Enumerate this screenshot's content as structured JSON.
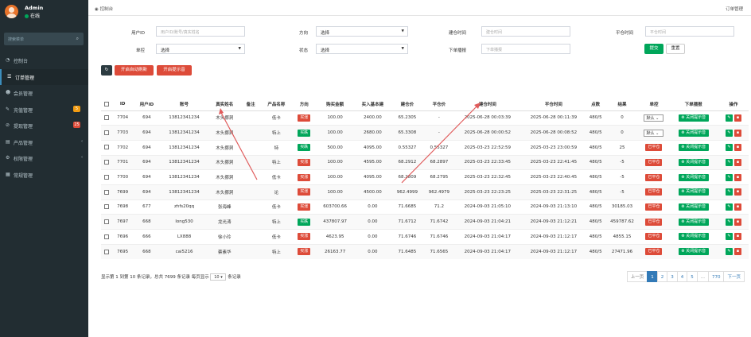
{
  "user": {
    "name": "Admin",
    "status": "在线"
  },
  "sidebar": {
    "search_placeholder": "搜索菜单",
    "items": [
      {
        "label": "控制台",
        "icon": "dashboard-icon"
      },
      {
        "label": "订单管理",
        "icon": "list-icon"
      },
      {
        "label": "会员管理",
        "icon": "users-icon"
      },
      {
        "label": "充值管理",
        "icon": "recharge-icon",
        "badge": "5"
      },
      {
        "label": "提现管理",
        "icon": "withdraw-icon",
        "badge": "25"
      },
      {
        "label": "产品管理",
        "icon": "product-icon"
      },
      {
        "label": "权限管理",
        "icon": "permission-icon"
      },
      {
        "label": "常规管理",
        "icon": "settings-icon"
      }
    ]
  },
  "topbar": {
    "breadcrumb": "控制台",
    "right": "订单管理"
  },
  "filters": {
    "user_id": {
      "label": "用户ID",
      "placeholder": "用户ID/账号/真实姓名"
    },
    "direction": {
      "label": "方向",
      "value": "选择"
    },
    "create_time": {
      "label": "建仓时间",
      "placeholder": "建仓时间"
    },
    "close_time": {
      "label": "平仓时间",
      "placeholder": "平仓时间"
    },
    "control": {
      "label": "单控",
      "value": "选择"
    },
    "status": {
      "label": "状态",
      "value": "选择"
    },
    "order_fee": {
      "label": "下单播报",
      "placeholder": "下单播报"
    },
    "submit": "提交",
    "reset": "重置"
  },
  "toolbar": {
    "refresh_icon": "refresh-icon",
    "auto_refresh": "开启自动刷新",
    "open_notify": "开启提示音"
  },
  "table": {
    "headers": [
      "",
      "ID",
      "用户ID",
      "账号",
      "真实姓名",
      "备注",
      "产品名称",
      "方向",
      "购买金额",
      "买入基本建",
      "建仓价",
      "平仓价",
      "建仓时间",
      "平仓时间",
      "点数",
      "结果",
      "单控",
      "下单播报",
      "操作"
    ],
    "rows": [
      {
        "id": "7704",
        "uid": "694",
        "account": "13812341234",
        "name": "木头挪洞",
        "note": "",
        "product": "低卡",
        "dir": "买涨",
        "dir_color": "#dd4b39",
        "amount": "100.00",
        "base": "2400.00",
        "open": "65.2305",
        "close": "-",
        "ctime": "2025-06-28 00:03:39",
        "ptime": "2025-06-28 00:11:39",
        "pts": "480/5",
        "result": "0",
        "ctrl": "select",
        "ctrl_val": "默认",
        "notify": "关闭提示音"
      },
      {
        "id": "7703",
        "uid": "694",
        "account": "13812341234",
        "name": "木头挪洞",
        "note": "",
        "product": "特上",
        "dir": "买跌",
        "dir_color": "#00a65a",
        "amount": "100.00",
        "base": "2680.00",
        "open": "65.3308",
        "close": "-",
        "ctime": "2025-06-28 00:00:52",
        "ptime": "2025-06-28 00:08:52",
        "pts": "480/5",
        "result": "0",
        "ctrl": "select",
        "ctrl_val": "默认",
        "notify": "关闭提示音"
      },
      {
        "id": "7702",
        "uid": "694",
        "account": "13812341234",
        "name": "木头挪洞",
        "note": "",
        "product": "特",
        "dir": "买跌",
        "dir_color": "#00a65a",
        "amount": "500.00",
        "base": "4095.00",
        "open": "0.55327",
        "close": "0.55327",
        "ctime": "2025-03-23 22:52:59",
        "ptime": "2025-03-23 23:00:59",
        "pts": "480/5",
        "result": "25",
        "ctrl": "status",
        "ctrl_val": "已平仓",
        "notify": "关闭提示音"
      },
      {
        "id": "7701",
        "uid": "694",
        "account": "13812341234",
        "name": "木头挪洞",
        "note": "",
        "product": "特上",
        "dir": "买涨",
        "dir_color": "#dd4b39",
        "amount": "100.00",
        "base": "4595.00",
        "open": "68.2912",
        "close": "68.2897",
        "ctime": "2025-03-23 22:33:45",
        "ptime": "2025-03-23 22:41:45",
        "pts": "480/5",
        "result": "-5",
        "ctrl": "status",
        "ctrl_val": "已平仓",
        "notify": "关闭提示音"
      },
      {
        "id": "7700",
        "uid": "694",
        "account": "13812341234",
        "name": "木头挪洞",
        "note": "",
        "product": "低卡",
        "dir": "买涨",
        "dir_color": "#dd4b39",
        "amount": "100.00",
        "base": "4095.00",
        "open": "68.2809",
        "close": "68.2795",
        "ctime": "2025-03-23 22:32:45",
        "ptime": "2025-03-23 22:40:45",
        "pts": "480/5",
        "result": "-5",
        "ctrl": "status",
        "ctrl_val": "已平仓",
        "notify": "关闭提示音"
      },
      {
        "id": "7699",
        "uid": "694",
        "account": "13812341234",
        "name": "木头挪洞",
        "note": "",
        "product": "论",
        "dir": "买涨",
        "dir_color": "#dd4b39",
        "amount": "100.00",
        "base": "4500.00",
        "open": "962.4999",
        "close": "962.4979",
        "ctime": "2025-03-23 22:23:25",
        "ptime": "2025-03-23 22:31:25",
        "pts": "480/5",
        "result": "-5",
        "ctrl": "status",
        "ctrl_val": "已平仓",
        "notify": "关闭提示音"
      },
      {
        "id": "7698",
        "uid": "677",
        "account": "zhfs20qq",
        "name": "张海峰",
        "note": "",
        "product": "低卡",
        "dir": "买涨",
        "dir_color": "#dd4b39",
        "amount": "603700.66",
        "base": "0.00",
        "open": "71.6685",
        "close": "71.2",
        "ctime": "2024-09-03 21:05:10",
        "ptime": "2024-09-03 21:13:10",
        "pts": "480/5",
        "result": "30185.03",
        "ctrl": "status",
        "ctrl_val": "已平仓",
        "notify": "关闭提示音"
      },
      {
        "id": "7697",
        "uid": "668",
        "account": "long530",
        "name": "龙光涛",
        "note": "",
        "product": "特上",
        "dir": "买跌",
        "dir_color": "#00a65a",
        "amount": "437807.97",
        "base": "0.00",
        "open": "71.6712",
        "close": "71.6742",
        "ctime": "2024-09-03 21:04:21",
        "ptime": "2024-09-03 21:12:21",
        "pts": "480/5",
        "result": "459787.62",
        "ctrl": "status",
        "ctrl_val": "已平仓",
        "notify": "关闭提示音"
      },
      {
        "id": "7696",
        "uid": "666",
        "account": "LX888",
        "name": "徐小玲",
        "note": "",
        "product": "低卡",
        "dir": "买涨",
        "dir_color": "#dd4b39",
        "amount": "4623.95",
        "base": "0.00",
        "open": "71.6746",
        "close": "71.6746",
        "ctime": "2024-09-03 21:04:17",
        "ptime": "2024-09-03 21:12:17",
        "pts": "480/5",
        "result": "4855.15",
        "ctrl": "status",
        "ctrl_val": "已平仓",
        "notify": "关闭提示音"
      },
      {
        "id": "7695",
        "uid": "668",
        "account": "cai5216",
        "name": "蔡素华",
        "note": "",
        "product": "特上",
        "dir": "买涨",
        "dir_color": "#dd4b39",
        "amount": "26163.77",
        "base": "0.00",
        "open": "71.6485",
        "close": "71.6565",
        "ctime": "2024-09-03 21:04:17",
        "ptime": "2024-09-03 21:12:17",
        "pts": "480/5",
        "result": "27471.96",
        "ctrl": "status",
        "ctrl_val": "已平仓",
        "notify": "关闭提示音"
      }
    ]
  },
  "footer": {
    "text_before": "显示第 1 到第 10 条记录，总共 7699 条记录 每页显示",
    "page_size": "10",
    "text_after": "条记录"
  },
  "pagination": [
    "上一页",
    "1",
    "2",
    "3",
    "4",
    "5",
    "...",
    "770",
    "下一页"
  ],
  "colors": {
    "accent": "#3c8dbc",
    "danger": "#dd4b39",
    "success": "#00a65a",
    "arrow": "#e05b5b"
  }
}
